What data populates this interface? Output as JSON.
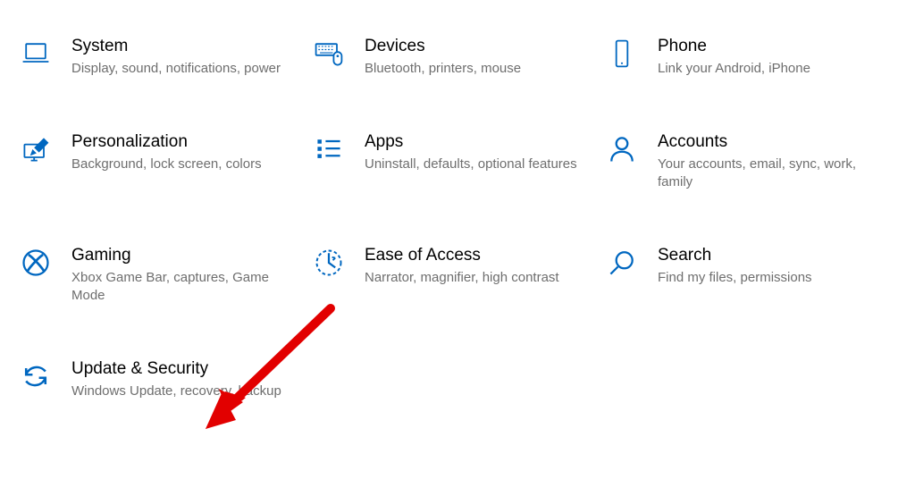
{
  "accent": "#0067c0",
  "tiles": [
    {
      "id": "system",
      "title": "System",
      "desc": "Display, sound, notifications, power",
      "icon": "laptop-icon"
    },
    {
      "id": "devices",
      "title": "Devices",
      "desc": "Bluetooth, printers, mouse",
      "icon": "keyboard-mouse-icon"
    },
    {
      "id": "phone",
      "title": "Phone",
      "desc": "Link your Android, iPhone",
      "icon": "phone-icon"
    },
    {
      "id": "personalization",
      "title": "Personalization",
      "desc": "Background, lock screen, colors",
      "icon": "paint-desktop-icon"
    },
    {
      "id": "apps",
      "title": "Apps",
      "desc": "Uninstall, defaults, optional features",
      "icon": "apps-list-icon"
    },
    {
      "id": "accounts",
      "title": "Accounts",
      "desc": "Your accounts, email, sync, work, family",
      "icon": "person-icon"
    },
    {
      "id": "gaming",
      "title": "Gaming",
      "desc": "Xbox Game Bar, captures, Game Mode",
      "icon": "xbox-icon"
    },
    {
      "id": "ease-of-access",
      "title": "Ease of Access",
      "desc": "Narrator, magnifier, high contrast",
      "icon": "ease-of-access-icon"
    },
    {
      "id": "search",
      "title": "Search",
      "desc": "Find my files, permissions",
      "icon": "search-icon"
    },
    {
      "id": "update-security",
      "title": "Update & Security",
      "desc": "Windows Update, recovery, backup",
      "icon": "sync-icon"
    }
  ],
  "annotation": {
    "type": "arrow",
    "color": "#e20000",
    "points_to": "update-security"
  }
}
